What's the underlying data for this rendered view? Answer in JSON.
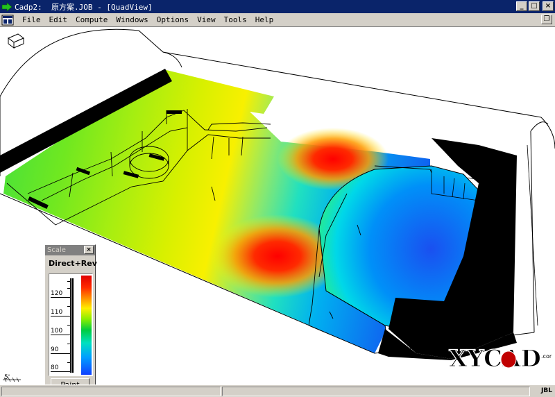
{
  "window": {
    "title": "Cadp2:  原方案.JOB - [QuadView]",
    "minimize_label": "_",
    "maximize_label": "□",
    "close_label": "×",
    "restore_label": "❐"
  },
  "menu": {
    "items": [
      "File",
      "Edit",
      "Compute",
      "Windows",
      "Options",
      "View",
      "Tools",
      "Help"
    ]
  },
  "scale_window": {
    "title": "Scale",
    "close_label": "×",
    "mode": "Direct+Rev",
    "ticks": [
      "120",
      "110",
      "100",
      "90",
      "80"
    ],
    "paint_label": "Paint"
  },
  "viewport": {
    "scale_ref": "5'",
    "logo_text": "XYCAD",
    "logo_suffix": ".com"
  },
  "status": {
    "brand": "JBL"
  },
  "colors": {
    "titlebar": "#0a246a",
    "chrome": "#d4d0c8",
    "hot": "#ff0000",
    "mid": "#ffee00",
    "cool": "#0060ff"
  }
}
